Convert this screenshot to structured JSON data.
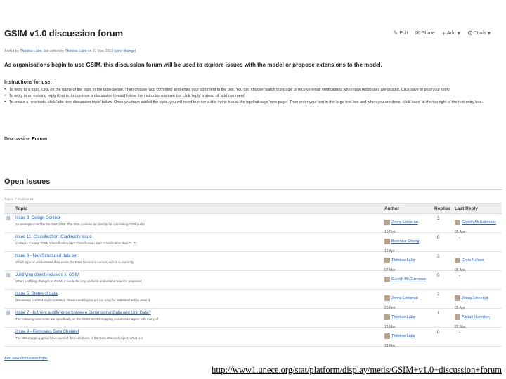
{
  "page": {
    "title": "GSIM v1.0 discussion forum",
    "actions": [
      {
        "label": "Edit",
        "icon": "pencil-icon"
      },
      {
        "label": "Share",
        "icon": "share-icon"
      },
      {
        "label": "Add",
        "icon": "plus-icon"
      },
      {
        "label": "Tools",
        "icon": "gear-icon"
      }
    ],
    "byline": {
      "prefix": "Added by",
      "author": "Thérèse Lalor",
      "middle": ", last edited by",
      "editor": "Thérèse Lalor",
      "date": "on 27 Mar, 2013",
      "view_change": "(view change)"
    },
    "intro": "As organisations begin to use GSIM, this discussion forum will be used to explore issues with the model or propose extensions to the model.",
    "instructions_heading": "Instructions for use:",
    "instructions": [
      "To reply to a topic, click on the name of the topic in the table below. Then choose 'add comment' and enter your comment in the box. You can choose 'watch this page' to receive email notifications when new responses are posted. Click save to post your reply.",
      "To reply to an existing reply (that is, to continue a discussion thread) follow the instructions above but click 'reply' instead of 'add comment'",
      "To create a new topic, click 'add new discussion topic' below. Once you have added the topic, you will need to enter a title in the box at the top that says 'new page'. Then enter your text in the large text box and when you are done, click 'save' at the top right of the text entry box."
    ],
    "discussion_heading": "Discussion Forum",
    "open_issues_heading": "Open Issues",
    "stats": "Topics: 7  Replies: 11",
    "table": {
      "headers": {
        "topic": "Topic",
        "author": "Author",
        "replies": "Replies",
        "last_reply": "Last Reply"
      },
      "rows": [
        {
          "topic": "Issue 3: Design Context",
          "excerpt": "An example could be the SNA 2008. The SNA contains an identity for calculating GDP (extra",
          "author": "Jenny Linnerud",
          "author_date": "19 Feb",
          "replies": "3",
          "last_name": "Gareth McGuinness",
          "last_date": "05 Apr"
        },
        {
          "topic": "Issue 11: Classification: Cardinality Issue",
          "excerpt": "Context - Current GSIM Classification Item    Classification Item   Classification Item \"1..*\"",
          "author": "Berenice Chong",
          "author_date": "12 Apr",
          "replies": "0",
          "last_name": "",
          "last_date": ""
        },
        {
          "topic": "Issue 6 - Non Structured data set",
          "excerpt": "Which type of unstructured data exists the Data Resource cannot, as it is is currently",
          "author": "Thérèse Lalor",
          "author_date": "07 Mar",
          "replies": "3",
          "last_name": "Chris Nelson",
          "last_date": "05 Apr"
        },
        {
          "topic": "Justifying object inclusion in GSIM",
          "excerpt": "When justifying changes to GSIM, it would be very useful to understand how the proposed",
          "author": "Gareth McGuinness",
          "author_date": "",
          "replies": "0",
          "last_name": "",
          "last_date": ""
        },
        {
          "topic": "Issue 5: States of data",
          "excerpt": "Discussion in GSIM Implementation Group Local layers are too easy for statistical action around",
          "author": "Jenny Linnerud",
          "author_date": "20 Feb",
          "replies": "2",
          "last_name": "Jenny Linnerud",
          "last_date": "05 Apr"
        },
        {
          "topic": "Issue 7 - Is there a difference between Dimensional Data and Unit Data?",
          "excerpt": "The following comments are specifically on the GSIM-SDMX mapping document. I agree with many of",
          "author": "Thérèse Lalor",
          "author_date": "19 Mar",
          "replies": "1",
          "last_name": "Alistair Hamilton",
          "last_date": "25 Mar"
        },
        {
          "topic": "Issue 9 - Removing Data Channel",
          "excerpt": "The DDI mapping group have queried the usefulness of the Data Channel object. What is s",
          "author": "Thérèse Lalor",
          "author_date": "21 Mar",
          "replies": "0",
          "last_name": "",
          "last_date": ""
        }
      ]
    },
    "add_link": "Add new discussion topic",
    "footer_url": "http://www1.unece.org/stat/platform/display/metis/GSIM+v1.0+discussion+forum"
  }
}
